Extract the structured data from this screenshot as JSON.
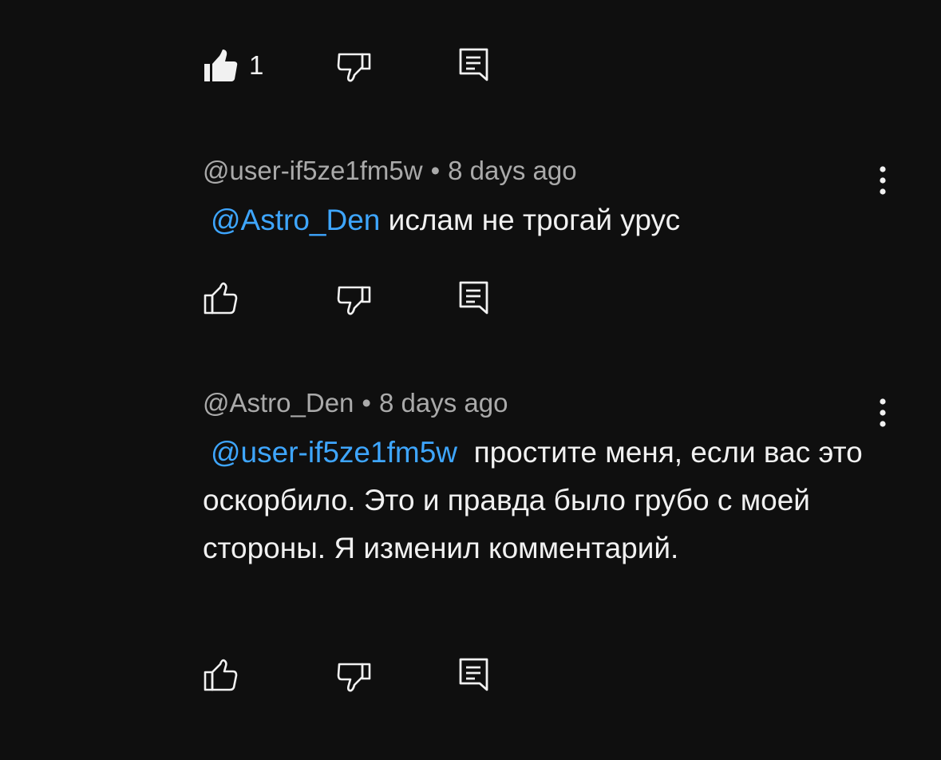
{
  "top_actions": {
    "like_count": "1",
    "like_icon": "thumb-up-filled-icon",
    "dislike_icon": "thumb-down-icon",
    "reply_icon": "reply-icon"
  },
  "comments": [
    {
      "author": "@user-if5ze1fm5w",
      "separator": "•",
      "time": "8 days ago",
      "mention": "@Astro_Den",
      "text": "ислам не трогай урус"
    },
    {
      "author": "@Astro_Den",
      "separator": "•",
      "time": "8 days ago",
      "mention": "@user-if5ze1fm5w",
      "text": "простите меня, если вас это оскорбило. Это и правда было грубо с моей стороны. Я изменил комментарий."
    }
  ],
  "colors": {
    "background": "#0f0f0f",
    "text": "#f1f1f1",
    "meta": "#aaaaaa",
    "mention": "#3ea6ff"
  }
}
